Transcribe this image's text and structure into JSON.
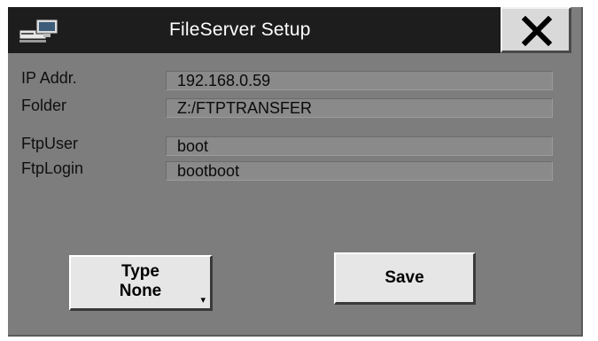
{
  "window": {
    "title": "FileServer Setup",
    "icons": {
      "app": "server-computer-icon",
      "close": "close-x-icon"
    }
  },
  "fields": [
    {
      "label": "IP  Addr.",
      "value": "192.168.0.59"
    },
    {
      "label": "Folder",
      "value": "Z:/FTPTRANSFER"
    },
    {
      "label": "FtpUser",
      "value": "boot"
    },
    {
      "label": "FtpLogin",
      "value": "bootboot"
    }
  ],
  "buttons": {
    "type_label": "Type",
    "type_value": "None",
    "type_icon": "dropdown-chevron-icon",
    "save_label": "Save"
  },
  "colors": {
    "background": "#7d7d7d",
    "titlebar": "#1d1d1d",
    "field": "#8a8a8a",
    "button": "#e6e6e6"
  }
}
